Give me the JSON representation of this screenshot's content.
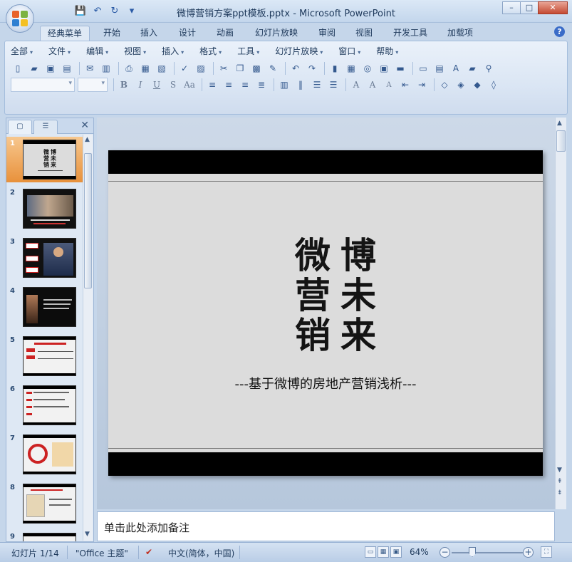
{
  "window": {
    "title": "微博营销方案ppt模板.pptx - Microsoft PowerPoint",
    "minimize": "–",
    "maximize": "□",
    "close": "✕"
  },
  "quick_access": {
    "save_icon": "save-icon",
    "undo_icon": "undo-icon",
    "redo_icon": "redo-icon",
    "customize": "▾"
  },
  "tabs": [
    {
      "label": "经典菜单",
      "active": true
    },
    {
      "label": "开始"
    },
    {
      "label": "插入"
    },
    {
      "label": "设计"
    },
    {
      "label": "动画"
    },
    {
      "label": "幻灯片放映"
    },
    {
      "label": "审阅"
    },
    {
      "label": "视图"
    },
    {
      "label": "开发工具"
    },
    {
      "label": "加载项"
    }
  ],
  "help": "?",
  "menubar": [
    {
      "label": "全部"
    },
    {
      "label": "文件"
    },
    {
      "label": "编辑"
    },
    {
      "label": "视图"
    },
    {
      "label": "插入"
    },
    {
      "label": "格式"
    },
    {
      "label": "工具"
    },
    {
      "label": "幻灯片放映"
    },
    {
      "label": "窗口"
    },
    {
      "label": "帮助"
    }
  ],
  "format_bar": {
    "bold": "B",
    "italic": "I",
    "underline": "U",
    "shadow": "S",
    "change_case": "Aa"
  },
  "slides_pane": {
    "tab_slides_icon": "slides-tab-icon",
    "tab_outline_icon": "outline-tab-icon",
    "close": "✕",
    "slide_numbers": [
      "1",
      "2",
      "3",
      "4",
      "5",
      "6",
      "7",
      "8",
      "9"
    ],
    "selected": 1,
    "thumb1_chars": [
      "微",
      "博",
      "营",
      "未",
      "销",
      "来"
    ]
  },
  "slide": {
    "calligraphy": [
      "微",
      "博",
      "营",
      "未",
      "销",
      "来"
    ],
    "subtitle": "---基于微博的房地产营销浅析---",
    "colors": {
      "background": "#dcdcdc",
      "band": "#000000"
    }
  },
  "notes": {
    "placeholder": "单击此处添加备注"
  },
  "status": {
    "slide_info": "幻灯片 1/14",
    "theme": "\"Office 主题\"",
    "language": "中文(简体，中国)",
    "zoom": "64%"
  }
}
